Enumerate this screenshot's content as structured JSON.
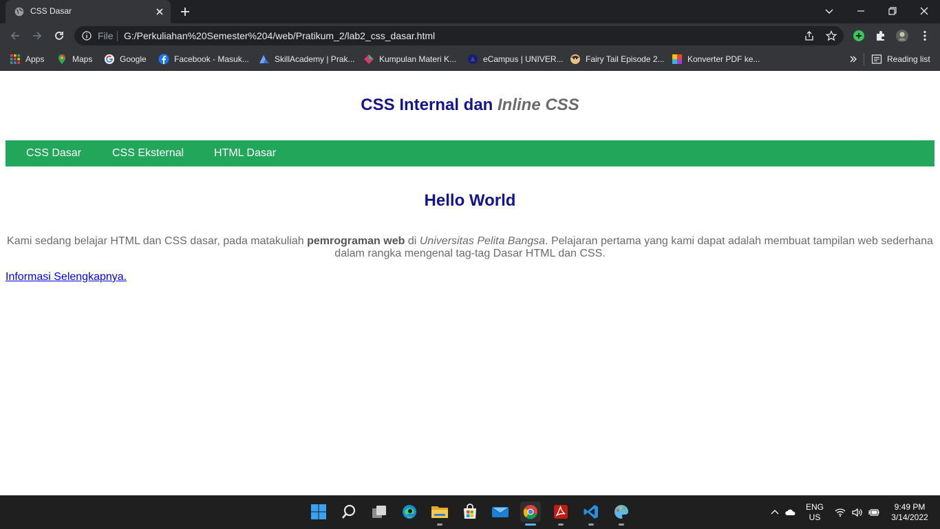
{
  "browser": {
    "tab": {
      "title": "CSS Dasar"
    },
    "omnibox": {
      "scheme_label": "File",
      "url": "G:/Perkuliahan%20Semester%204/web/Pratikum_2/lab2_css_dasar.html"
    },
    "bookmarks": [
      {
        "label": "Apps",
        "icon": "apps-grid-icon"
      },
      {
        "label": "Maps",
        "icon": "maps-pin-icon"
      },
      {
        "label": "Google",
        "icon": "google-icon"
      },
      {
        "label": "Facebook - Masuk...",
        "icon": "facebook-icon"
      },
      {
        "label": "SkillAcademy | Prak...",
        "icon": "skillacademy-icon"
      },
      {
        "label": "Kumpulan Materi K...",
        "icon": "kumpulan-materi-icon"
      },
      {
        "label": "eCampus | UNIVER...",
        "icon": "ecampus-icon"
      },
      {
        "label": "Fairy Tail Episode 2...",
        "icon": "fairy-tail-icon"
      },
      {
        "label": "Konverter PDF ke...",
        "icon": "pdf-converter-icon"
      }
    ],
    "reading_list_label": "Reading list"
  },
  "page": {
    "title_main": "CSS Internal dan ",
    "title_italic": "Inline CSS",
    "nav": [
      "CSS Dasar",
      "CSS Eksternal",
      "HTML Dasar"
    ],
    "heading": "Hello World",
    "paragraph": {
      "part1": "Kami sedang belajar HTML dan CSS dasar, pada matakuliah ",
      "bold": "pemrograman web",
      "part2": " di ",
      "italic": "Universitas Pelita Bangsa",
      "part3": ". Pelajaran pertama yang kami dapat adalah membuat tampilan web sederhana dalam rangka mengenal tag-tag Dasar HTML dan CSS."
    },
    "link_text": "Informasi Selengkapnya."
  },
  "taskbar": {
    "apps": [
      "start-icon",
      "search-icon",
      "task-view-icon",
      "edge-icon",
      "file-explorer-icon",
      "microsoft-store-icon",
      "mail-icon",
      "chrome-icon",
      "acrobat-icon",
      "vscode-icon",
      "paint-icon"
    ],
    "active_app": "chrome-icon",
    "language_line1": "ENG",
    "language_line2": "US",
    "time": "9:49 PM",
    "date": "3/14/2022"
  },
  "colors": {
    "heading": "#14148c",
    "nav_bar": "#22a75a",
    "body_text": "#6b6b6b",
    "link": "#0000ee"
  }
}
